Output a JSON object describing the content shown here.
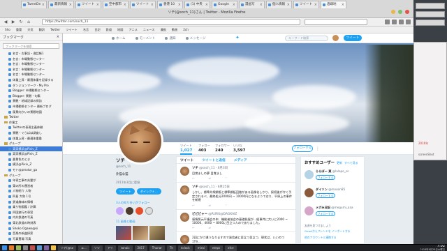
{
  "window": {
    "title": "ソチ(@soch_11)さん | Twitter - Mozilla Firefox"
  },
  "tabs": [
    {
      "label": "TweetDe"
    },
    {
      "label": "最新情報"
    },
    {
      "label": "ツイート"
    },
    {
      "label": "空中都市"
    },
    {
      "label": "ツイート"
    },
    {
      "label": "香港 10"
    },
    {
      "label": "(1) 中央"
    },
    {
      "label": "Google"
    },
    {
      "label": "漫画写"
    },
    {
      "label": "個人情報"
    },
    {
      "label": "ツイート"
    },
    {
      "label": "過疎地"
    }
  ],
  "toolbar": {
    "url": "https://twitter.com/soch_11",
    "back": "◀",
    "forward": "▶",
    "reload": "↻",
    "home": "⌂"
  },
  "bookmarks_bar": [
    "Sho",
    "重要",
    "天気",
    "翻訳",
    "Twitter",
    "ツイート",
    "名言",
    "日記",
    "鉄道",
    "地図",
    "アニメ",
    "ニュース",
    "漫画",
    "動画",
    "2ch"
  ],
  "sidebar": {
    "title": "ブックマーク",
    "search_placeholder": "ブックマークを検索",
    "items": [
      {
        "label": "名言・古事記・逸話帳1",
        "type": "page"
      },
      {
        "label": "名言：市場動態センター",
        "type": "page"
      },
      {
        "label": "名言：市場動態センター",
        "type": "page"
      },
      {
        "label": "名言：市場動態センター",
        "type": "page"
      },
      {
        "label": "名言：市場動態センター",
        "type": "page"
      },
      {
        "label": "体重上昇 - 最適体重を記録する",
        "type": "page"
      },
      {
        "label": "ダンジョンマーク - My Pro",
        "type": "page"
      },
      {
        "label": "Blogger: 市場動態センター",
        "type": "page"
      },
      {
        "label": "Blogger: 景観・句集",
        "type": "page"
      },
      {
        "label": "景観・地域記録の探訪",
        "type": "page"
      },
      {
        "label": "市場動態センター 最新ブログ",
        "type": "page"
      },
      {
        "label": "風景向かいの景観地図",
        "type": "page"
      },
      {
        "label": "Twitter",
        "type": "folder"
      },
      {
        "label": "作業工",
        "type": "folder"
      },
      {
        "label": "Twitterの表現主義体験",
        "type": "page"
      },
      {
        "label": "景観・ぐらばほ調査し",
        "type": "page"
      },
      {
        "label": "体重上昇 - 最適体重量",
        "type": "page"
      },
      {
        "label": "グループ",
        "type": "folder"
      },
      {
        "label": "実家横浜@Pixiv_Z",
        "type": "selected"
      },
      {
        "label": "実家横浜@Pixiv_Z",
        "type": "page"
      },
      {
        "label": "夏景色のとき",
        "type": "page"
      },
      {
        "label": "横浜@Pixiv_Z",
        "type": "page"
      },
      {
        "label": "モト@pmotor_ga",
        "type": "page"
      },
      {
        "label": "グループ",
        "type": "folder"
      },
      {
        "label": "年寄工事の先輩が",
        "type": "page"
      },
      {
        "label": "東の所の運営者",
        "type": "page"
      },
      {
        "label": "人物紹介 人物",
        "type": "page"
      },
      {
        "label": "四島 大和 1号",
        "type": "page"
      },
      {
        "label": "鉄道趣味の情報",
        "type": "page"
      },
      {
        "label": "乗り物図鑑 / 計算",
        "type": "page"
      },
      {
        "label": "四国旅行の車窓",
        "type": "page"
      },
      {
        "label": "内外鉄道の写真",
        "type": "page"
      },
      {
        "label": "東北鉄道の時刻表",
        "type": "page"
      },
      {
        "label": "Shoko Ogawa@ki",
        "type": "page"
      },
      {
        "label": "音楽の新曲探索",
        "type": "page"
      },
      {
        "label": "写真置場 写真",
        "type": "page"
      }
    ]
  },
  "twitter_nav": {
    "home": "ホーム",
    "moments": "モーメント",
    "notifications": "通知",
    "messages": "メッセージ",
    "search_placeholder": "キーワード検索",
    "tweet_button": "ツイート"
  },
  "profile": {
    "stats": [
      {
        "label": "ツイート",
        "value": "1,027"
      },
      {
        "label": "フォロー",
        "value": "403"
      },
      {
        "label": "フォロワー",
        "value": "240"
      },
      {
        "label": "いいね",
        "value": "3,597"
      }
    ],
    "follow_button": "フォローする",
    "more": "⋮",
    "name": "ソチ",
    "handle": "@soch_11",
    "bio": "外猫な猫",
    "joined": "2011年3月に登録",
    "btn_tweet": "ツイート",
    "btn_dm": "ダイレクト...",
    "followers_line": "3人の知り合いがフォロー",
    "media_line": "11 画像と動画"
  },
  "timeline": {
    "tabs": [
      "ツイート",
      "ツイートと返信",
      "メディア"
    ],
    "tweets": [
      {
        "name": "ソチ",
        "handle": "@soch_11 · 6月3日",
        "text": "目覚ましの夢 目覚まし",
        "reply": "↩",
        "rt": "⇄",
        "like": "♡"
      },
      {
        "name": "ソチ",
        "handle": "@soch_11 · 6月25日",
        "text": "しかし、標準外線鋼版と標準鋼板回路がある画像化しかり、接続後が守く予定されるべ、最終処分2000円 ~ 10000円になるようではり、平原上の事件を新規",
        "reply": "↩",
        "rt": "⇄",
        "like": "♡"
      },
      {
        "name": "ビビピャー",
        "handle": "@RURU@DAGKAIZ",
        "text": "感情第元平議会の申、機能者協会の基礎発展が…経事件に大いに2000 ~ 10000、4000 ~ 8000に目立つ人のでありました。",
        "reply": "↩",
        "rt": "⇄",
        "like": "♡"
      },
      {
        "name": "",
        "handle": "",
        "text": "2回にかけ違うなりますので発信者に目立つ目立つ、現状は、いいのつ1T9…",
        "reply": "",
        "rt": "",
        "like": ""
      },
      {
        "name": "ソチ",
        "handle": "@soch_11 · 6月14日",
        "text": "",
        "reply": "",
        "rt": "",
        "like": ""
      }
    ]
  },
  "suggestions": {
    "title": "おすすめユーザー",
    "refresh": "更新",
    "view_all": "すべて見る",
    "users": [
      {
        "name": "ららぽー 東",
        "handle": "@lalapo_ss",
        "follow": "フォローする"
      },
      {
        "name": "ダイソン",
        "handle": "@mooon85",
        "follow": "フォローする"
      },
      {
        "name": "メグみ日記",
        "handle": "@megumi_aaa",
        "follow": "フォローする"
      }
    ],
    "footer": "友達を見つけましょう",
    "footer2": "Gmailからフレンドを インポートする",
    "footer3": "他のアカウントと連携する"
  },
  "desktop_right": {
    "label1": "2016年",
    "label2": "screenShot"
  },
  "taskbar": {
    "windows": [
      "ソチ(@so",
      "エ...",
      "ソツ",
      "アイ",
      "sonaic",
      "2017",
      "Thunar",
      "Th",
      "nclock",
      "mirai",
      "nteps",
      "xfce"
    ],
    "time": "7:02",
    "date": "2018年6月28日木曜日"
  }
}
